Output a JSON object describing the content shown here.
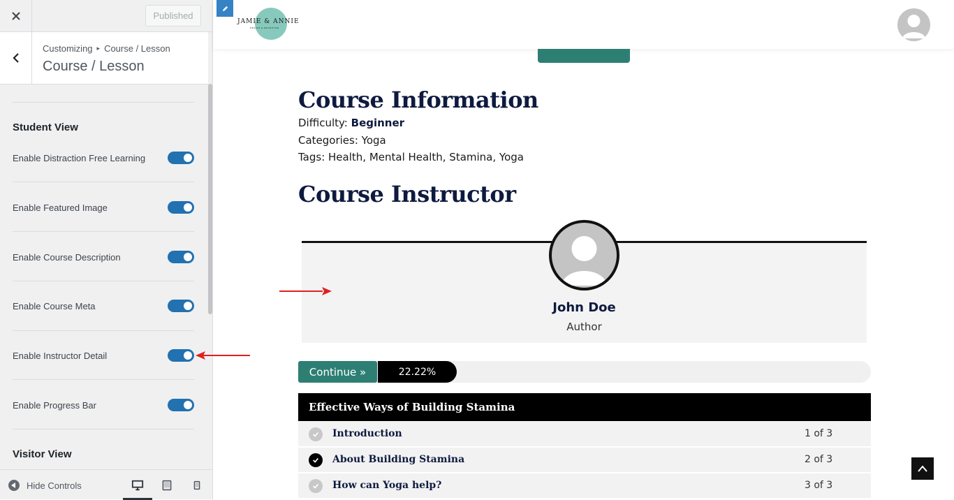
{
  "customizer": {
    "publish_label": "Published",
    "breadcrumb_root": "Customizing",
    "breadcrumb_sep": "▸",
    "breadcrumb_leaf": "Course / Lesson",
    "section_title": "Course / Lesson",
    "student_view_heading": "Student View",
    "visitor_view_heading": "Visitor View",
    "toggles": [
      {
        "label": "Enable Distraction Free Learning",
        "on": true
      },
      {
        "label": "Enable Featured Image",
        "on": true
      },
      {
        "label": "Enable Course Description",
        "on": true
      },
      {
        "label": "Enable Course Meta",
        "on": true
      },
      {
        "label": "Enable Instructor Detail",
        "on": true
      },
      {
        "label": "Enable Progress Bar",
        "on": true
      }
    ],
    "hide_controls_label": "Hide Controls",
    "devices": [
      "desktop-icon",
      "tablet-icon",
      "mobile-icon"
    ],
    "accent": "#2271b1"
  },
  "site": {
    "logo_name": "JAMIE & ANNIE",
    "logo_tagline": "HEALTH & NUTRITION",
    "brand_teal": "#2e7f73"
  },
  "course": {
    "info_heading": "Course Information",
    "difficulty_label": "Difficulty: ",
    "difficulty_value": "Beginner",
    "categories": "Categories: Yoga",
    "tags": "Tags: Health, Mental Health, Stamina, Yoga",
    "instructor_heading": "Course Instructor",
    "instructor_name": "John Doe",
    "instructor_role": "Author",
    "continue_label": "Continue »",
    "progress_label": "22.22%",
    "progress": 0.2222,
    "lesson_group_title": "Effective Ways of Building Stamina",
    "lessons": [
      {
        "title": "Introduction",
        "count": "1 of 3",
        "completed": false
      },
      {
        "title": "About Building  Stamina",
        "count": "2 of 3",
        "completed": true
      },
      {
        "title": "How can Yoga help?",
        "count": "3 of 3",
        "completed": false
      }
    ]
  }
}
